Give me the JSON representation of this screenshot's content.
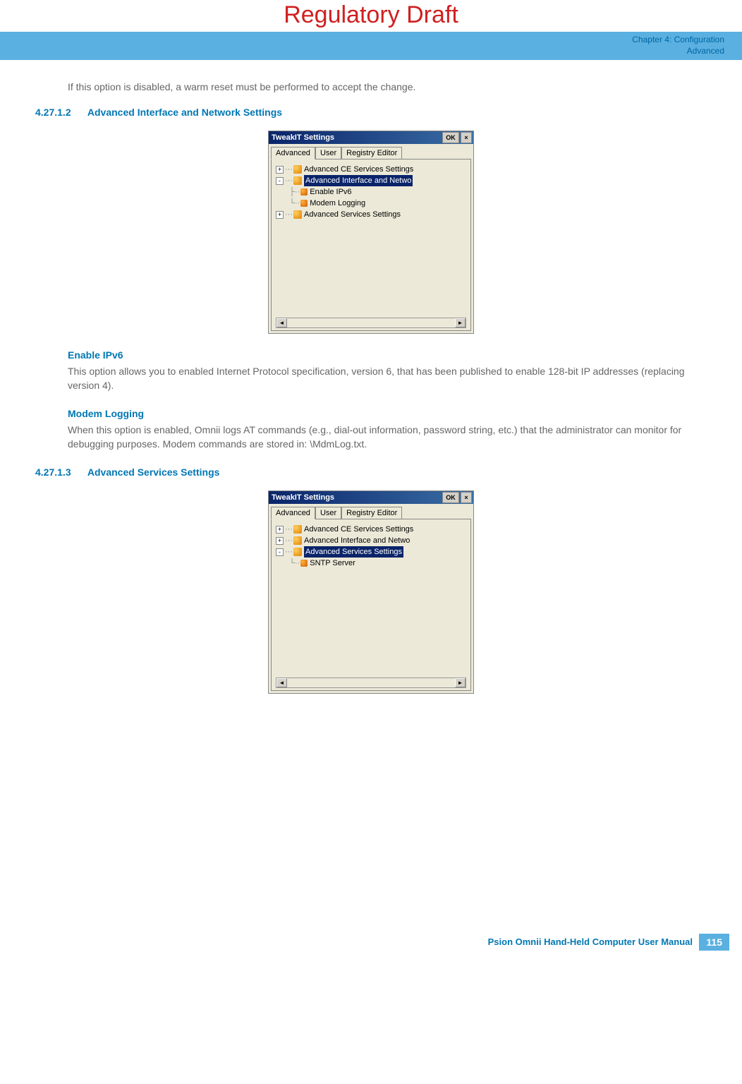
{
  "watermark": "Regulatory Draft",
  "header": {
    "chapter": "Chapter 4:  Configuration",
    "subtitle": "Advanced"
  },
  "intro": "If this option is disabled, a warm reset must be performed to accept the change.",
  "section1": {
    "number": "4.27.1.2",
    "title": "Advanced Interface and Network Settings"
  },
  "screenshot1": {
    "title": "TweakIT Settings",
    "ok": "OK",
    "close": "×",
    "tabs": {
      "advanced": "Advanced",
      "user": "User",
      "registry": "Registry Editor"
    },
    "tree": {
      "n1": "Advanced CE Services Settings",
      "n2": "Advanced Interface and Netwo",
      "n2a": "Enable IPv6",
      "n2b": "Modem Logging",
      "n3": "Advanced Services Settings"
    }
  },
  "sub1": {
    "title": "Enable IPv6",
    "body": "This option allows you to enabled Internet Protocol specification, version 6, that has been published to enable 128-bit IP addresses (replacing version 4)."
  },
  "sub2": {
    "title": "Modem Logging",
    "body": "When this option is enabled, Omnii logs AT commands (e.g., dial-out information, password string, etc.) that the administrator can monitor for debugging purposes. Modem commands are stored in: \\MdmLog.txt."
  },
  "section2": {
    "number": "4.27.1.3",
    "title": "Advanced Services Settings"
  },
  "screenshot2": {
    "title": "TweakIT Settings",
    "ok": "OK",
    "close": "×",
    "tabs": {
      "advanced": "Advanced",
      "user": "User",
      "registry": "Registry Editor"
    },
    "tree": {
      "n1": "Advanced CE Services Settings",
      "n2": "Advanced Interface and Netwo",
      "n3": "Advanced Services Settings",
      "n3a": "SNTP Server"
    }
  },
  "footer": {
    "text": "Psion Omnii Hand-Held Computer User Manual",
    "page": "115"
  }
}
